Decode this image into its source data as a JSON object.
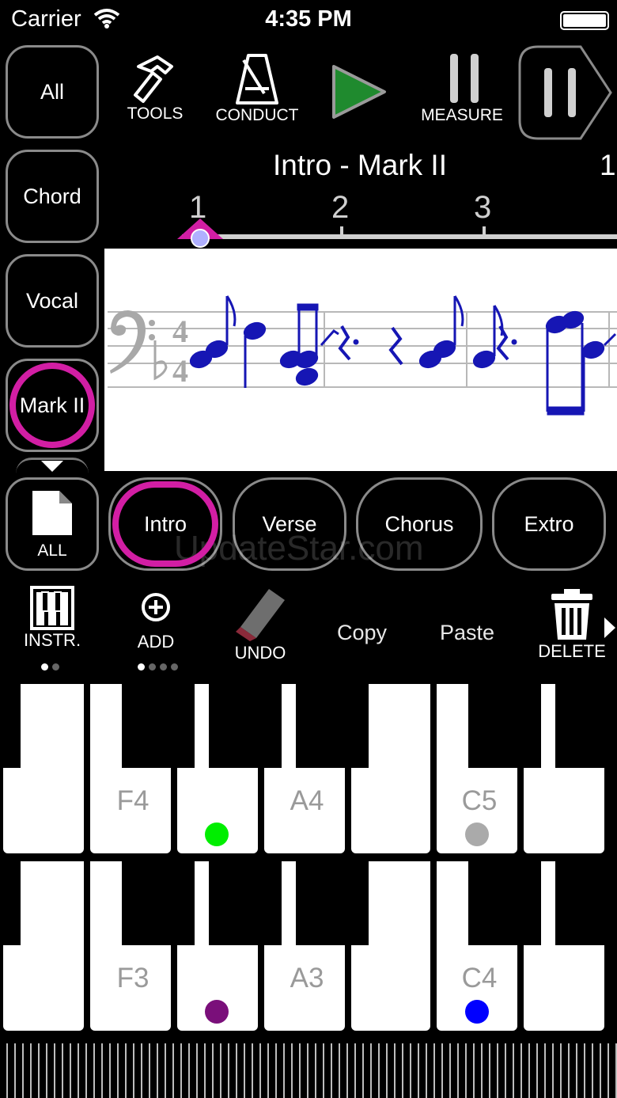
{
  "status_bar": {
    "carrier": "Carrier",
    "time": "4:35 PM"
  },
  "side_tracks": [
    {
      "label": "All"
    },
    {
      "label": "Chord"
    },
    {
      "label": "Vocal"
    },
    {
      "label": "Mark II",
      "selected": true
    }
  ],
  "toolbar": {
    "tools_label": "TOOLS",
    "conduct_label": "CONDUCT",
    "measure_label": "MEASURE"
  },
  "score": {
    "title": "Intro - Mark II",
    "page": "1",
    "measures": [
      "1",
      "2",
      "3"
    ],
    "time_signature": [
      "4",
      "4"
    ]
  },
  "sections": {
    "all_label": "ALL",
    "items": [
      {
        "label": "Intro",
        "selected": true
      },
      {
        "label": "Verse"
      },
      {
        "label": "Chorus"
      },
      {
        "label": "Extro"
      }
    ]
  },
  "watermark": "UpdateStar.com",
  "edit_bar": {
    "instr_label": "INSTR.",
    "add_label": "ADD",
    "undo_label": "UNDO",
    "copy_label": "Copy",
    "paste_label": "Paste",
    "delete_label": "DELETE"
  },
  "keyboards": {
    "upper": {
      "labels": [
        "F4",
        "A4",
        "C5"
      ]
    },
    "lower": {
      "labels": [
        "F3",
        "A3",
        "C4"
      ]
    }
  },
  "colors": {
    "accent_ring": "#d21ea4",
    "note_blue": "#1616b4",
    "play_green": "#1f8a2e",
    "dot_green": "#00ee00",
    "dot_gray": "#aaaaaa",
    "dot_purple": "#7a0f7a",
    "dot_blue": "#0000ff"
  }
}
